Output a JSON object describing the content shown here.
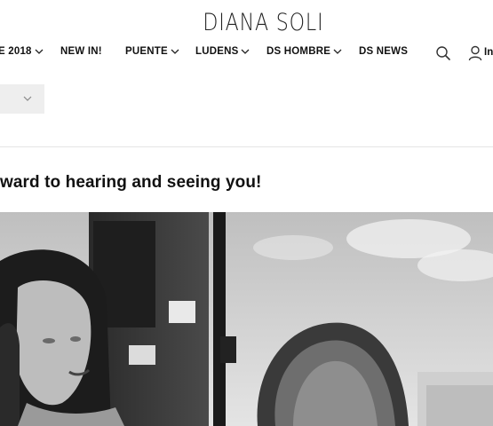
{
  "header": {
    "logo": "DIANA SOLI",
    "nav": [
      {
        "label": "E 2018",
        "has_dropdown": true
      },
      {
        "label": "NEW IN!",
        "has_dropdown": false
      },
      {
        "label": "PUENTE",
        "has_dropdown": true
      },
      {
        "label": "LUDENS",
        "has_dropdown": true
      },
      {
        "label": "DS HOMBRE",
        "has_dropdown": true
      },
      {
        "label": "DS NEWS",
        "has_dropdown": false
      }
    ],
    "icons": {
      "search": "search-icon",
      "user": "user-icon"
    },
    "login_partial": "In"
  },
  "selector": {
    "icon": "chevron-down-icon"
  },
  "main": {
    "heading": "ward to hearing and seeing you!"
  },
  "colors": {
    "text": "#111111",
    "select_bg": "#eeeeee",
    "divider": "#e5e5e5"
  }
}
